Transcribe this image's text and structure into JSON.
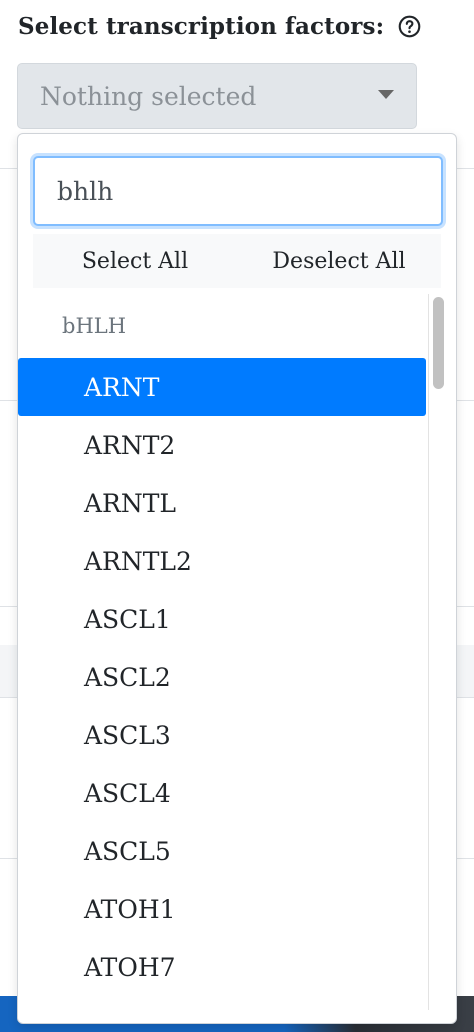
{
  "field": {
    "label": "Select transcription factors:",
    "help_icon": "question-circle-icon"
  },
  "select": {
    "placeholder": "Nothing selected",
    "caret_icon": "caret-down-icon"
  },
  "dropdown": {
    "search_value": "bhlh",
    "select_all_label": "Select All",
    "deselect_all_label": "Deselect All",
    "group_label": "bHLH",
    "options": [
      "ARNT",
      "ARNT2",
      "ARNTL",
      "ARNTL2",
      "ASCL1",
      "ASCL2",
      "ASCL3",
      "ASCL4",
      "ASCL5",
      "ATOH1",
      "ATOH7"
    ],
    "active_option": "ARNT"
  },
  "colors": {
    "active_bg": "#007bff",
    "focus_border": "#80bdff",
    "toggle_bg": "#e2e6ea"
  }
}
